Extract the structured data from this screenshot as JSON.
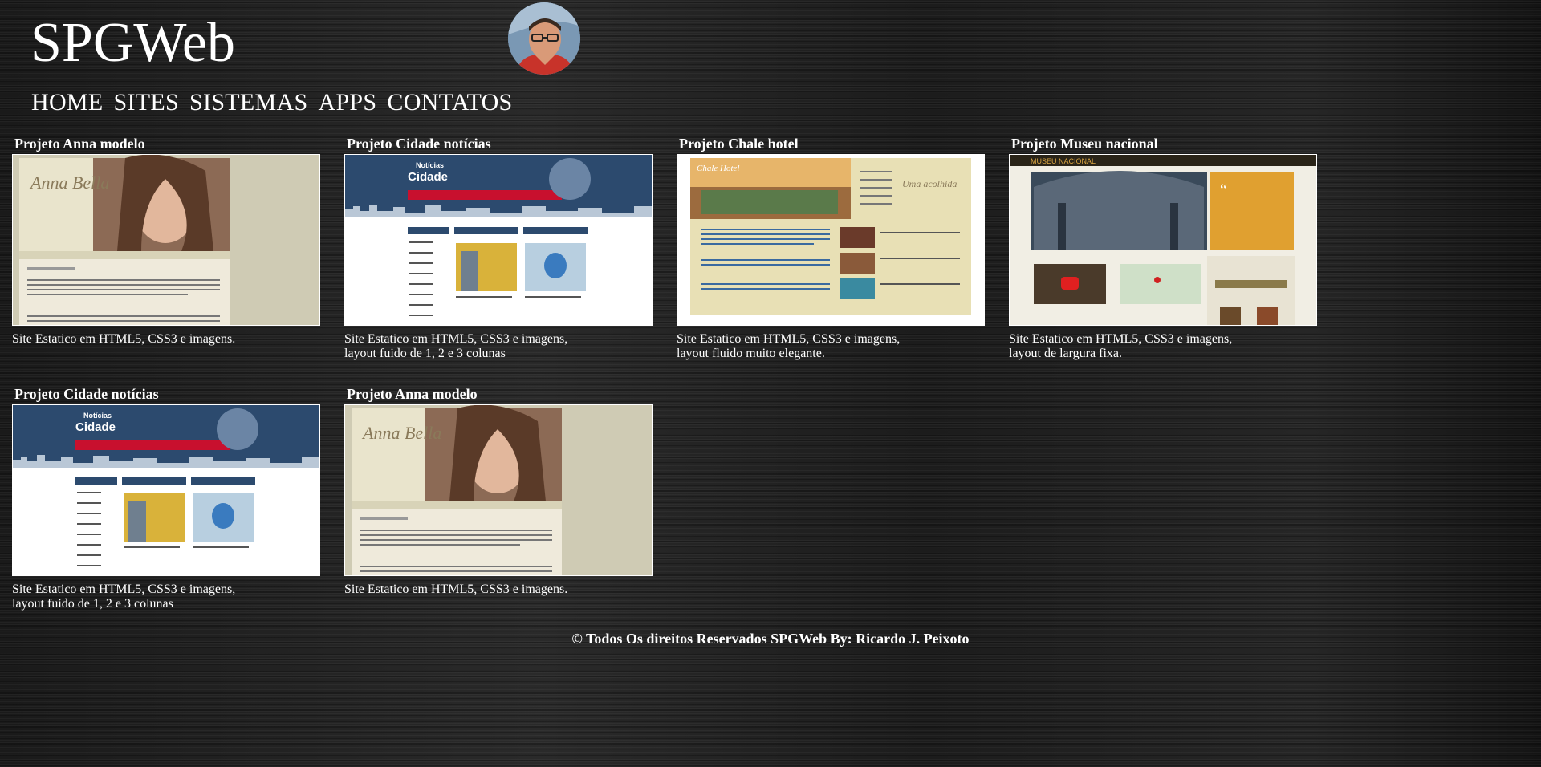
{
  "site": {
    "logo": "SPGWeb"
  },
  "nav": [
    "HOME",
    "SITES",
    "SISTEMAS",
    "APPS",
    "CONTATOS"
  ],
  "projects": [
    {
      "title": "Projeto Anna modelo",
      "desc": "Site Estatico em HTML5, CSS3 e imagens.",
      "thumb": "anna"
    },
    {
      "title": "Projeto Cidade notícias",
      "desc": "Site Estatico em HTML5, CSS3 e imagens, layout fuido de 1, 2 e 3 colunas",
      "thumb": "cidade"
    },
    {
      "title": "Projeto Chale hotel",
      "desc": "Site Estatico em HTML5, CSS3 e imagens, layout fluido muito elegante.",
      "thumb": "chale"
    },
    {
      "title": "Projeto Museu nacional",
      "desc": "Site Estatico em HTML5, CSS3 e imagens, layout de largura fixa.",
      "thumb": "museu"
    },
    {
      "title": "Projeto Cidade notícias",
      "desc": "Site Estatico em HTML5, CSS3 e imagens, layout fuido de 1, 2 e 3 colunas",
      "thumb": "cidade"
    },
    {
      "title": "Projeto Anna modelo",
      "desc": "Site Estatico em HTML5, CSS3 e imagens.",
      "thumb": "anna"
    }
  ],
  "footer": "© Todos Os direitos Reservados SPGWeb By: Ricardo J. Peixoto",
  "colors": {
    "background": "#1e1e1e",
    "text": "#ffffff",
    "cidade_header": "#2c4a6e",
    "cidade_nav": "#c8102e",
    "anna_bg": "#d9d5be",
    "chale_bg": "#e8e0b5",
    "museu_header": "#2a2418"
  }
}
